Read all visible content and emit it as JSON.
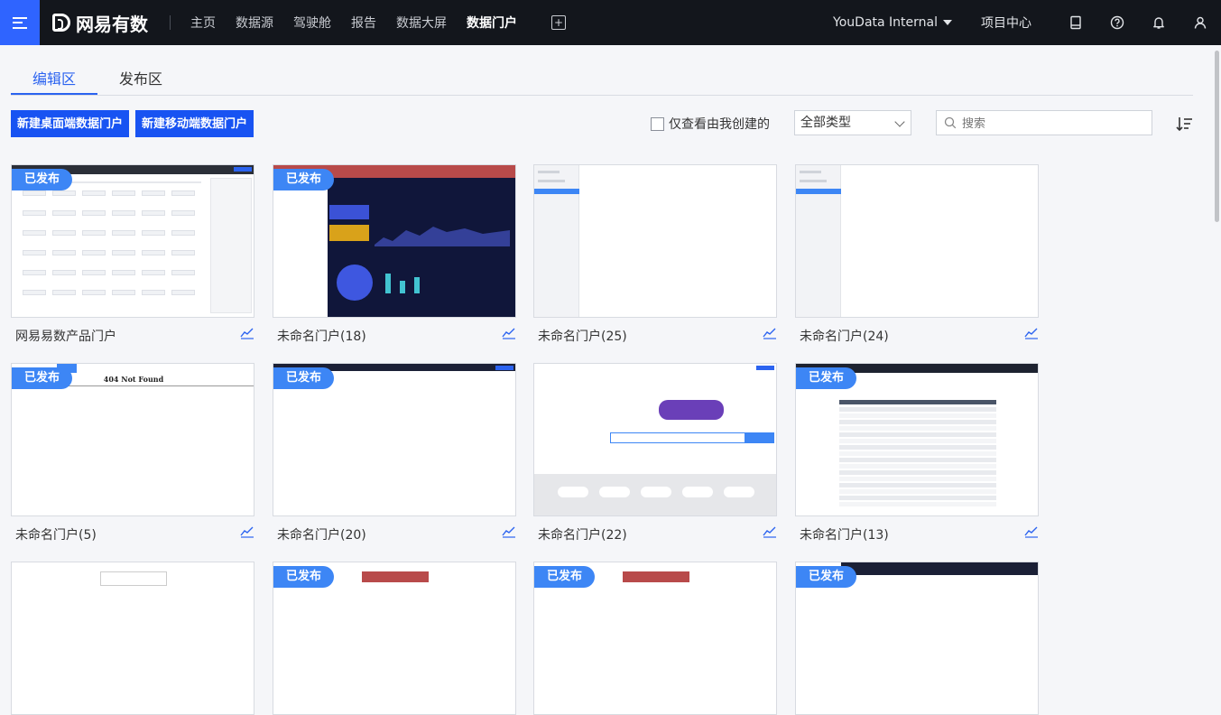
{
  "topbar": {
    "brand": "网易有数",
    "nav": [
      "主页",
      "数据源",
      "驾驶舱",
      "报告",
      "数据大屏",
      "数据门户"
    ],
    "active_nav": "数据门户",
    "org": "YouData Internal",
    "project_center": "项目中心"
  },
  "tabs": [
    "编辑区",
    "发布区"
  ],
  "toolbar": {
    "new_desktop": "新建桌面端数据门户",
    "new_mobile": "新建移动端数据门户",
    "only_mine": "仅查看由我创建的",
    "type_select": "全部类型",
    "search_placeholder": "搜索"
  },
  "published_label": "已发布",
  "cards": [
    {
      "name": "网易易数产品门户",
      "published": true,
      "style": "portal"
    },
    {
      "name": "未命名门户(18)",
      "published": true,
      "style": "dark"
    },
    {
      "name": "未命名门户(25)",
      "published": false,
      "style": "sidebar"
    },
    {
      "name": "未命名门户(24)",
      "published": false,
      "style": "sidebar"
    },
    {
      "name": "未命名门户(5)",
      "published": true,
      "style": "notfound",
      "thumb_text": "404 Not Found"
    },
    {
      "name": "未命名门户(20)",
      "published": true,
      "style": "blank"
    },
    {
      "name": "未命名门户(22)",
      "published": false,
      "style": "search"
    },
    {
      "name": "未命名门户(13)",
      "published": true,
      "style": "table"
    },
    {
      "name": "",
      "published": false,
      "style": "partial"
    },
    {
      "name": "",
      "published": true,
      "style": "partial-red"
    },
    {
      "name": "",
      "published": true,
      "style": "partial-red"
    },
    {
      "name": "",
      "published": true,
      "style": "partial-dark"
    }
  ],
  "colors": {
    "accent": "#1853f2",
    "badge": "#3d86f5",
    "topbar": "#13161c"
  }
}
